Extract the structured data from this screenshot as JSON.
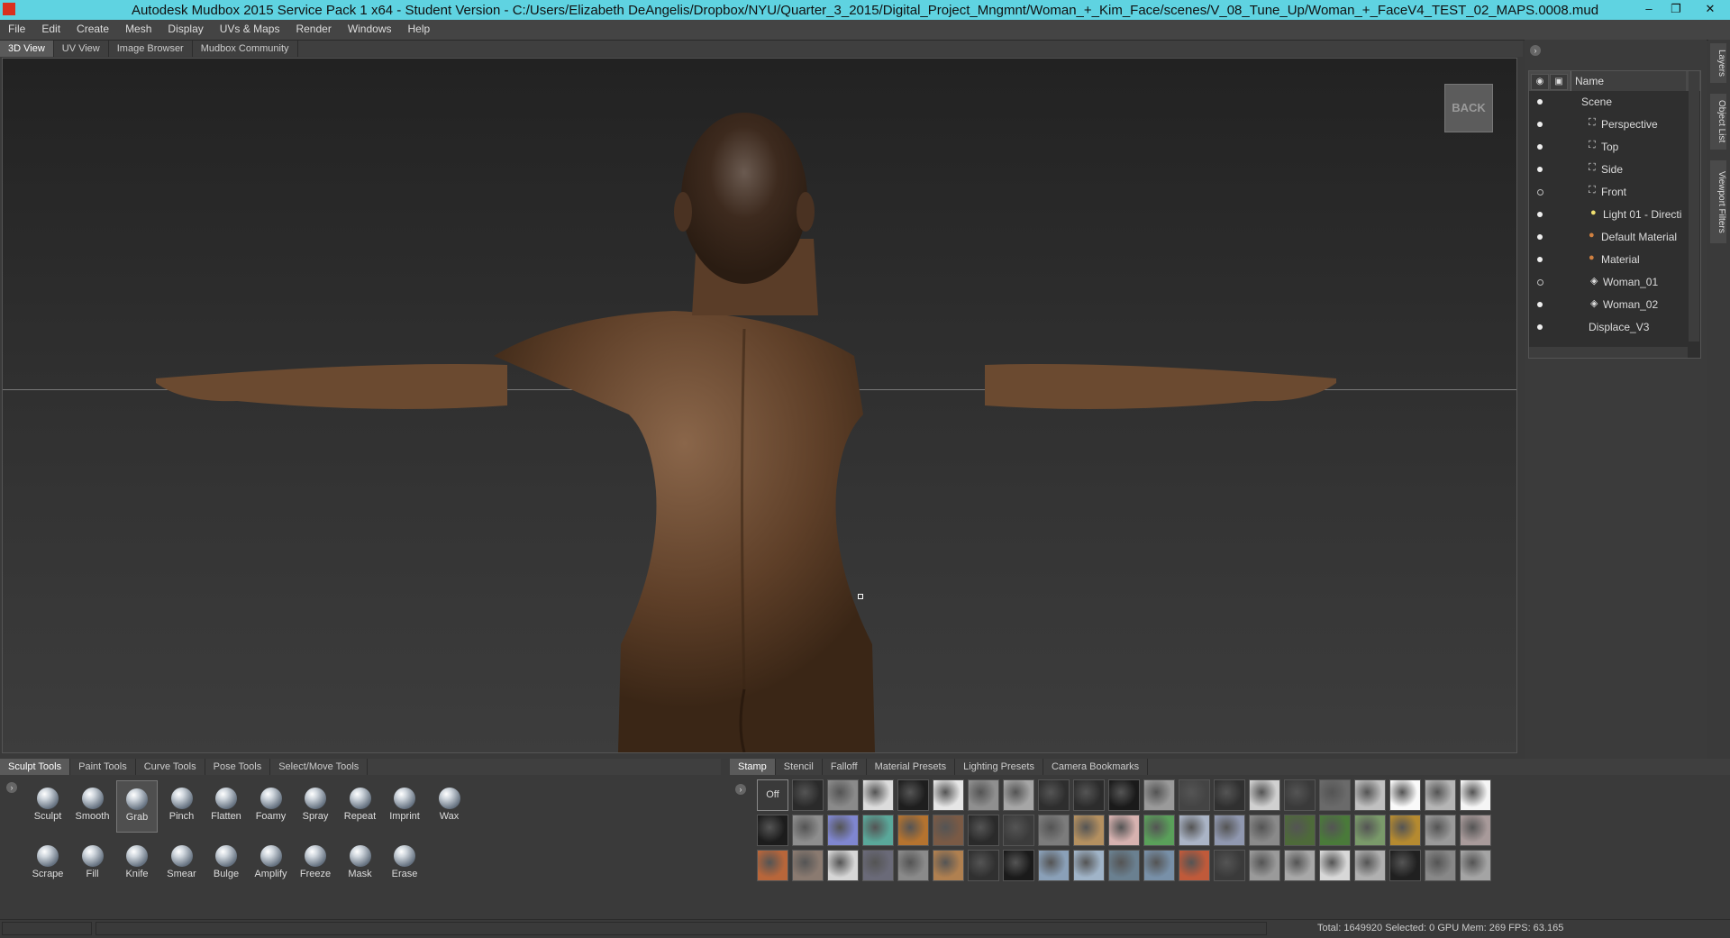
{
  "window": {
    "title": "Autodesk Mudbox 2015 Service Pack 1 x64 - Student Version - C:/Users/Elizabeth DeAngelis/Dropbox/NYU/Quarter_3_2015/Digital_Project_Mngmnt/Woman_+_Kim_Face/scenes/V_08_Tune_Up/Woman_+_FaceV4_TEST_02_MAPS.0008.mud",
    "minimize": "–",
    "restore": "❐",
    "close": "✕"
  },
  "menu": [
    "File",
    "Edit",
    "Create",
    "Mesh",
    "Display",
    "UVs & Maps",
    "Render",
    "Windows",
    "Help"
  ],
  "view_tabs": [
    {
      "label": "3D View",
      "active": true
    },
    {
      "label": "UV View",
      "active": false
    },
    {
      "label": "Image Browser",
      "active": false
    },
    {
      "label": "Mudbox Community",
      "active": false
    }
  ],
  "viewport": {
    "back_button": "BACK",
    "model_color": "#6b4a30"
  },
  "object_list": {
    "header_name": "Name",
    "eye_icon": "eye-icon",
    "lock_icon": "lock-icon",
    "rows": [
      {
        "label": "Scene",
        "icon": "",
        "visible": true
      },
      {
        "label": "Perspective",
        "icon": "camera-icon",
        "visible": true
      },
      {
        "label": "Top",
        "icon": "camera-icon",
        "visible": true
      },
      {
        "label": "Side",
        "icon": "camera-icon",
        "visible": true
      },
      {
        "label": "Front",
        "icon": "camera-icon",
        "visible": false
      },
      {
        "label": "Light 01 - Directi",
        "icon": "light-icon",
        "visible": true
      },
      {
        "label": "Default Material",
        "icon": "material-icon",
        "visible": true
      },
      {
        "label": "Material",
        "icon": "material-icon",
        "visible": true
      },
      {
        "label": "Woman_01",
        "icon": "mesh-icon",
        "visible": false
      },
      {
        "label": "Woman_02",
        "icon": "mesh-icon",
        "visible": true
      },
      {
        "label": "Displace_V3",
        "icon": "",
        "visible": true
      }
    ]
  },
  "side_tabs": [
    "Layers",
    "Object List",
    "Viewport Filters"
  ],
  "tool_tabs": [
    {
      "label": "Sculpt Tools",
      "active": true
    },
    {
      "label": "Paint Tools",
      "active": false
    },
    {
      "label": "Curve Tools",
      "active": false
    },
    {
      "label": "Pose Tools",
      "active": false
    },
    {
      "label": "Select/Move Tools",
      "active": false
    }
  ],
  "sculpt_tools": {
    "row1": [
      "Sculpt",
      "Smooth",
      "Grab",
      "Pinch",
      "Flatten",
      "Foamy",
      "Spray",
      "Repeat",
      "Imprint",
      "Wax"
    ],
    "row2": [
      "Scrape",
      "Fill",
      "Knife",
      "Smear",
      "Bulge",
      "Amplify",
      "Freeze",
      "Mask",
      "Erase"
    ],
    "active": "Grab"
  },
  "stamp_tabs": [
    {
      "label": "Stamp",
      "active": true
    },
    {
      "label": "Stencil",
      "active": false
    },
    {
      "label": "Falloff",
      "active": false
    },
    {
      "label": "Material Presets",
      "active": false
    },
    {
      "label": "Lighting Presets",
      "active": false
    },
    {
      "label": "Camera Bookmarks",
      "active": false
    }
  ],
  "stamps": {
    "off_label": "Off",
    "row1": [
      "#2a2a2a",
      "#8a8a8a",
      "#dcdcdc",
      "#1e1e1e",
      "#e6e6e6",
      "#8f8f8f",
      "#a6a6a6",
      "#2e2e2e",
      "#2c2c2c",
      "#1a1a1a",
      "#9a9a9a",
      "#444444",
      "#303030",
      "#d0d0d0",
      "#3a3a3a",
      "#6a6a6a",
      "#c0c0c0",
      "#fafafa",
      "#b5b5b5",
      "#f5f5f5"
    ],
    "row2": [
      "#1c1c1c",
      "#8e8e8e",
      "#7f86d0",
      "#5aa89a",
      "#b5732f",
      "#7a5a45",
      "#2a2a2a",
      "#3b3b3b",
      "#7c7c7c",
      "#b49060",
      "#d7b2b0",
      "#5aa05a",
      "#aab4c6",
      "#9098b0",
      "#8a8a8a",
      "#4e6a3a",
      "#4a7a3a",
      "#7a9a6a",
      "#b58a30",
      "#9a9a9a",
      "#a89a9a"
    ],
    "row3": [
      "#b8663a",
      "#8a7a70",
      "#d6d6d6",
      "#6a6a78",
      "#8a8a8a",
      "#b08050",
      "#303030",
      "#1a1a1a",
      "#8aa0b8",
      "#a0b4c8",
      "#6a8090",
      "#7890a8",
      "#c05a3a",
      "#3a3a3a",
      "#9a9a9a",
      "#a8a8a8",
      "#d8d8d8",
      "#b0b0b0",
      "#202020",
      "#888888",
      "#a4a4a4"
    ]
  },
  "status": {
    "text": "Total: 1649920  Selected: 0 GPU Mem: 269  FPS: 63.165"
  }
}
